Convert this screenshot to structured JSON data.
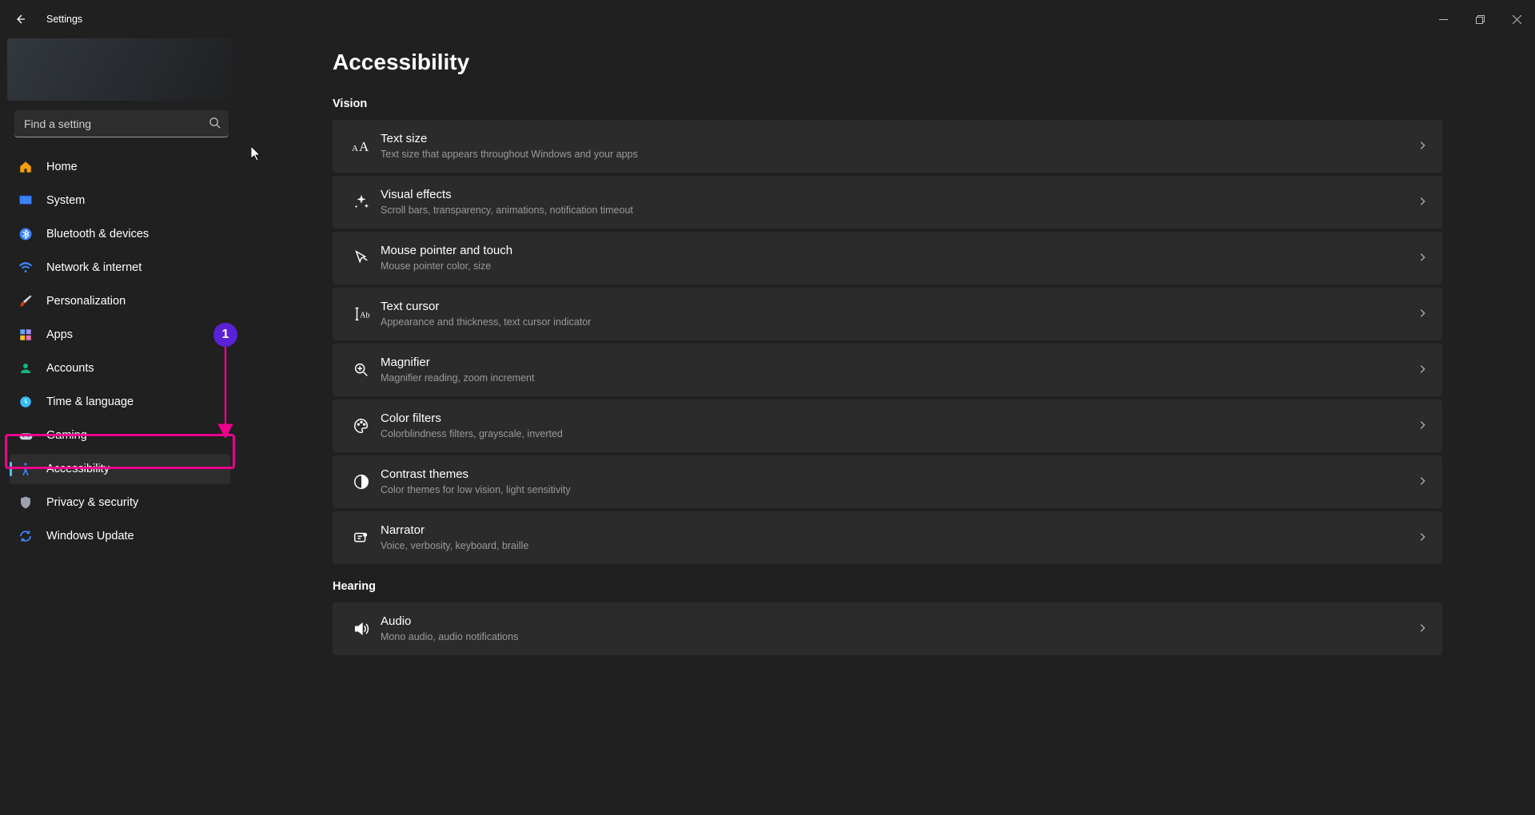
{
  "titlebar": {
    "title": "Settings"
  },
  "search": {
    "placeholder": "Find a setting"
  },
  "nav": {
    "items": [
      {
        "label": "Home"
      },
      {
        "label": "System"
      },
      {
        "label": "Bluetooth & devices"
      },
      {
        "label": "Network & internet"
      },
      {
        "label": "Personalization"
      },
      {
        "label": "Apps"
      },
      {
        "label": "Accounts"
      },
      {
        "label": "Time & language"
      },
      {
        "label": "Gaming"
      },
      {
        "label": "Accessibility"
      },
      {
        "label": "Privacy & security"
      },
      {
        "label": "Windows Update"
      }
    ]
  },
  "page": {
    "title": "Accessibility",
    "sections": {
      "vision": "Vision",
      "hearing": "Hearing"
    },
    "cards": {
      "text_size": {
        "title": "Text size",
        "desc": "Text size that appears throughout Windows and your apps"
      },
      "visual_effects": {
        "title": "Visual effects",
        "desc": "Scroll bars, transparency, animations, notification timeout"
      },
      "mouse_pointer": {
        "title": "Mouse pointer and touch",
        "desc": "Mouse pointer color, size"
      },
      "text_cursor": {
        "title": "Text cursor",
        "desc": "Appearance and thickness, text cursor indicator"
      },
      "magnifier": {
        "title": "Magnifier",
        "desc": "Magnifier reading, zoom increment"
      },
      "color_filters": {
        "title": "Color filters",
        "desc": "Colorblindness filters, grayscale, inverted"
      },
      "contrast_themes": {
        "title": "Contrast themes",
        "desc": "Color themes for low vision, light sensitivity"
      },
      "narrator": {
        "title": "Narrator",
        "desc": "Voice, verbosity, keyboard, braille"
      },
      "audio": {
        "title": "Audio",
        "desc": "Mono audio, audio notifications"
      }
    }
  },
  "annotation": {
    "badge": "1"
  }
}
